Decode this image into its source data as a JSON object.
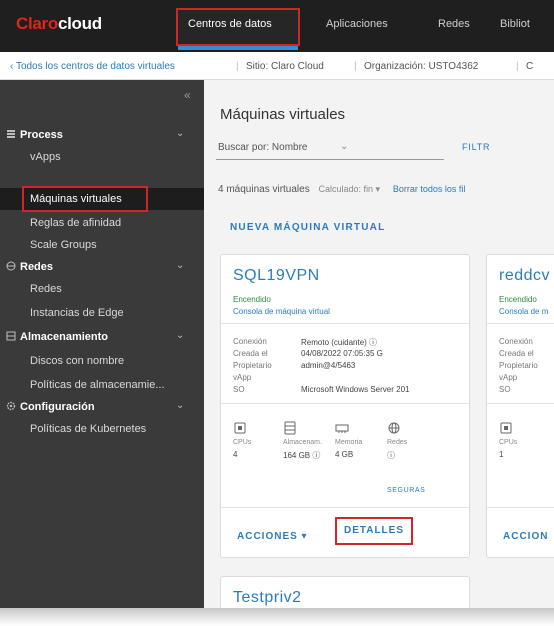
{
  "brand": {
    "left": "Claro",
    "right": "cloud"
  },
  "nav": {
    "tabs": [
      "Centros de datos",
      "Aplicaciones",
      "Redes",
      "Bibliot"
    ]
  },
  "breadcrumb": {
    "back": "Todos los centros de datos virtuales",
    "site": "Sitio: Claro Cloud",
    "org": "Organización: USTO4362",
    "tail": "C"
  },
  "sidebar": {
    "handle": "«",
    "process": {
      "label": "Process",
      "items": [
        "vApps",
        "Máquinas virtuales",
        "Reglas de afinidad",
        "Scale Groups"
      ]
    },
    "redes": {
      "label": "Redes",
      "items": [
        "Redes",
        "Instancias de Edge"
      ]
    },
    "almacenamiento": {
      "label": "Almacenamiento",
      "items": [
        "Discos con nombre",
        "Políticas de almacenamie..."
      ]
    },
    "configuracion": {
      "label": "Configuración",
      "items": [
        "Políticas de Kubernetes"
      ]
    }
  },
  "main": {
    "title": "Máquinas virtuales",
    "sort_label": "Buscar por: Nombre",
    "filter": "FILTR",
    "count_text": "4 máquinas virtuales",
    "count_sub": "Calculado: fin ▾",
    "count_link": "Borrar todos los fil",
    "new_vm": "NUEVA MÁQUINA VIRTUAL"
  },
  "cards": [
    {
      "name": "SQL19VPN",
      "status": "Encendido",
      "console": "Consola de máquina virtual",
      "props": [
        {
          "label": "Conexión",
          "value": "Remoto (cuidante) ⓘ"
        },
        {
          "label": "Creada el",
          "value": "04/08/2022 07:05:35 G"
        },
        {
          "label": "Propietario",
          "value": "admin@4/5463"
        },
        {
          "label": "vApp",
          "value": ""
        },
        {
          "label": "SO",
          "value": "Microsoft Windows Server 201"
        }
      ],
      "metrics": [
        {
          "icon": "cpu-icon",
          "label": "CPUs",
          "value": "4"
        },
        {
          "icon": "memory-icon",
          "label": "Almacenam.",
          "value": "164 GB ⓘ"
        },
        {
          "icon": "ram-icon",
          "label": "Memoria",
          "value": "4 GB"
        },
        {
          "icon": "network-icon",
          "label": "Redes",
          "value": "ⓘ"
        }
      ],
      "cross_link": "SEGURAS",
      "actions": "ACCIONES ▾",
      "details": "DETALLES"
    },
    {
      "name": "reddcv",
      "status": "Encendido",
      "console": "Consola de m",
      "props": [
        {
          "label": "Conexión",
          "value": ""
        },
        {
          "label": "Creada el",
          "value": ""
        },
        {
          "label": "Propietario",
          "value": ""
        },
        {
          "label": "vApp",
          "value": ""
        },
        {
          "label": "SO",
          "value": ""
        }
      ],
      "metrics": [
        {
          "icon": "cpu-icon",
          "label": "CPUs",
          "value": "1"
        }
      ],
      "actions": "ACCION"
    },
    {
      "name": "Testpriv2"
    }
  ],
  "colors": {
    "accent": "#2a7dbd",
    "highlight": "#d0262b",
    "sidebar": "#3a3a3a",
    "topbar": "#1f1f1f",
    "status_on": "#2a8a3a"
  }
}
